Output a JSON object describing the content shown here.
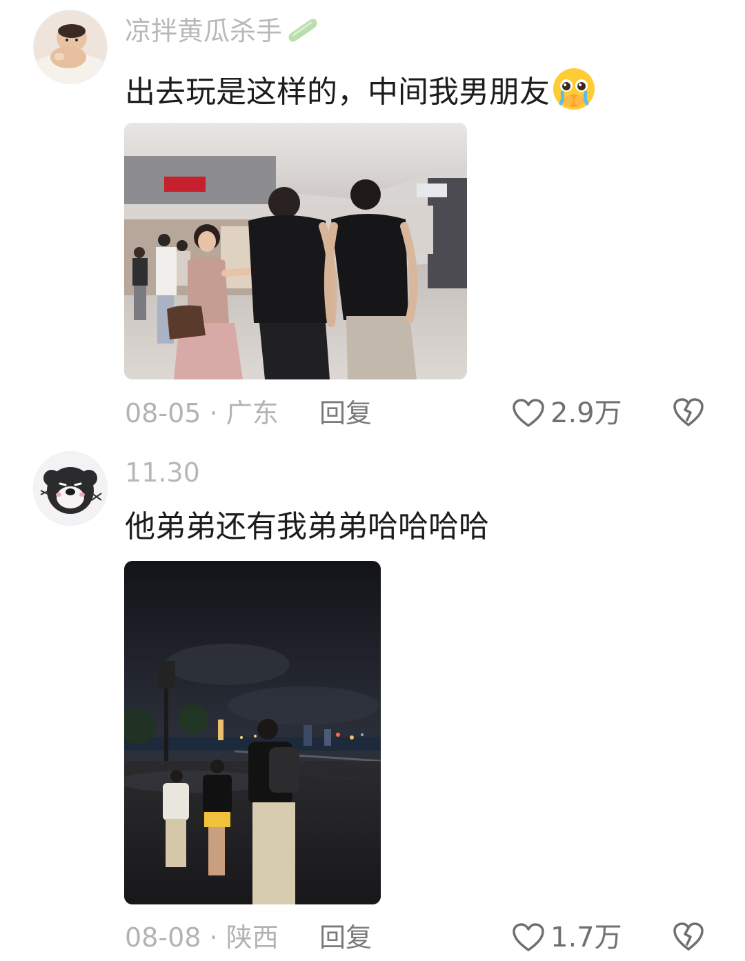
{
  "comments": [
    {
      "username": "凉拌黄瓜杀手",
      "text": "出去玩是这样的，中间我男朋友",
      "date": "08-05",
      "separator": "·",
      "location": "广东",
      "reply_label": "回复",
      "likes": "2.9万",
      "username_suffix_icon": "cucumber-icon",
      "text_emoji": "crying-face-emoji"
    },
    {
      "username": "11.30",
      "text": "他弟弟还有我弟弟哈哈哈哈",
      "date": "08-08",
      "separator": "·",
      "location": "陕西",
      "reply_label": "回复",
      "likes": "1.7万"
    }
  ],
  "colors": {
    "background": "#ffffff",
    "username": "#b8b8b8",
    "text": "#1c1c1c",
    "meta": "#b3b3b3",
    "action": "#707070"
  }
}
